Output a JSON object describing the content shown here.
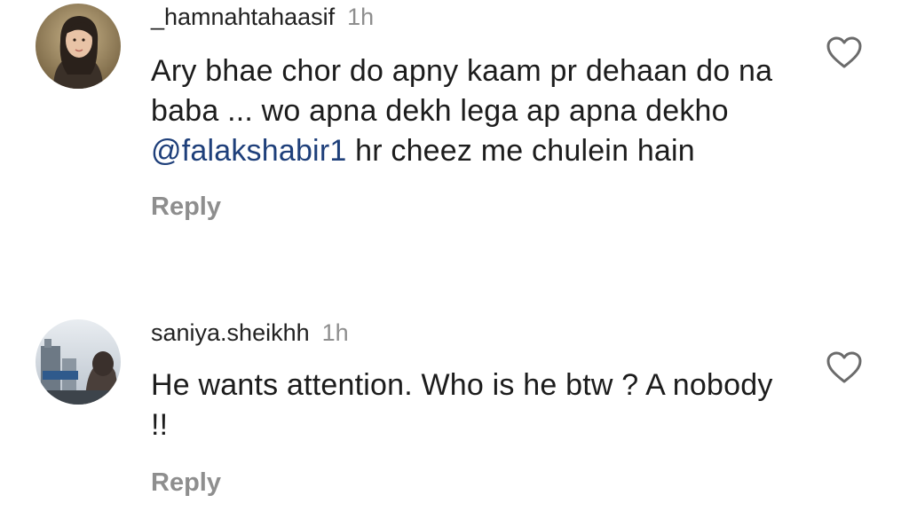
{
  "comments": [
    {
      "username": "_hamnahtahaasif",
      "time": "1h",
      "text_before": "Ary bhae chor do apny kaam pr dehaan do na baba ... wo apna dekh lega ap apna dekho ",
      "mention": "@falakshabir1",
      "text_after": " hr cheez me chulein hain",
      "reply_label": "Reply",
      "like_icon": "heart-outline-icon"
    },
    {
      "username": "saniya.sheikhh",
      "time": "1h",
      "text": "He wants attention. Who is he btw ? A nobody !!",
      "reply_label": "Reply",
      "like_icon": "heart-outline-icon"
    }
  ]
}
